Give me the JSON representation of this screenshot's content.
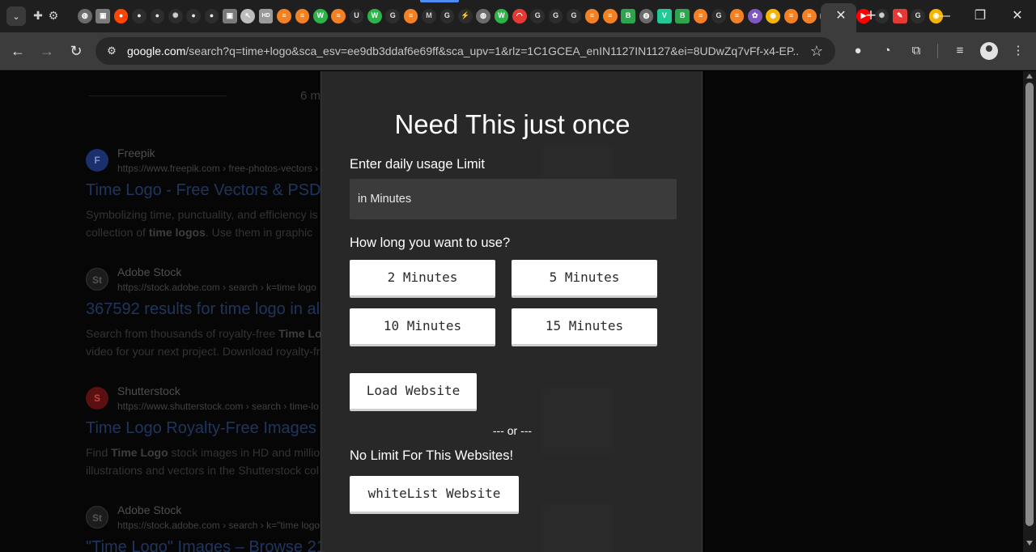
{
  "browser": {
    "address_bar": {
      "host": "google.com",
      "path": "/search?q=time+logo&sca_esv=ee9db3ddaf6e69ff&sca_upv=1&rlz=1C1GCEA_enIN1127IN1127&ei=8UDwZq7vFf-x4-EP..."
    },
    "tabs": [
      {
        "icon": "globe-icon",
        "color": "#6b6b6b"
      },
      {
        "icon": "image-icon",
        "color": "#7a7a7a"
      },
      {
        "icon": "reddit-icon",
        "color": "#ff4500"
      },
      {
        "icon": "github-icon",
        "color": "#e6e6e6"
      },
      {
        "icon": "github-icon",
        "color": "#e6e6e6"
      },
      {
        "icon": "openai-icon",
        "color": "#d0d0d0"
      },
      {
        "icon": "github-icon",
        "color": "#e6e6e6"
      },
      {
        "icon": "github-icon",
        "color": "#e6e6e6"
      },
      {
        "icon": "image-icon",
        "color": "#7a7a7a"
      },
      {
        "icon": "cursor-icon",
        "color": "#bdbdbd"
      },
      {
        "icon": "hd-icon",
        "color": "#9a9a9a"
      },
      {
        "icon": "stackoverflow-icon",
        "color": "#f48024"
      },
      {
        "icon": "stackoverflow-icon",
        "color": "#f48024"
      },
      {
        "icon": "w-icon",
        "color": "#2db34a"
      },
      {
        "icon": "stackoverflow-icon",
        "color": "#f48024"
      },
      {
        "icon": "u-icon",
        "color": "#e6e6e6"
      },
      {
        "icon": "w-icon",
        "color": "#2db34a"
      },
      {
        "icon": "google-icon",
        "color": "#e6e6e6"
      },
      {
        "icon": "stackoverflow-icon",
        "color": "#f48024"
      },
      {
        "icon": "m-icon",
        "color": "#d0d0d0"
      },
      {
        "icon": "google-icon",
        "color": "#e6e6e6"
      },
      {
        "icon": "link-icon",
        "color": "#d0d0d0"
      },
      {
        "icon": "globe-icon",
        "color": "#6b6b6b"
      },
      {
        "icon": "w-icon",
        "color": "#2db34a"
      },
      {
        "icon": "wifi-icon",
        "color": "#e53935"
      },
      {
        "icon": "google-icon",
        "color": "#e6e6e6"
      },
      {
        "icon": "google-icon",
        "color": "#e6e6e6"
      },
      {
        "icon": "google-icon",
        "color": "#e6e6e6"
      },
      {
        "icon": "stackoverflow-icon",
        "color": "#f48024"
      },
      {
        "icon": "stackoverflow-icon",
        "color": "#f48024"
      },
      {
        "icon": "b-icon",
        "color": "#2ea44f"
      },
      {
        "icon": "globe-icon",
        "color": "#6b6b6b"
      },
      {
        "icon": "v-icon",
        "color": "#20c997"
      },
      {
        "icon": "b-icon",
        "color": "#2ea44f"
      },
      {
        "icon": "stackoverflow-icon",
        "color": "#f48024"
      },
      {
        "icon": "google-icon",
        "color": "#e6e6e6"
      },
      {
        "icon": "stackoverflow-icon",
        "color": "#f48024"
      },
      {
        "icon": "ext-icon",
        "color": "#7e57c2"
      },
      {
        "icon": "chrome-icon",
        "color": "#f4b400"
      },
      {
        "icon": "stackoverflow-icon",
        "color": "#f48024"
      },
      {
        "icon": "stackoverflow-icon",
        "color": "#f48024"
      },
      {
        "icon": "stackoverflow-icon",
        "color": "#f48024"
      },
      {
        "icon": "google-icon",
        "color": "#e6e6e6"
      },
      {
        "icon": "youtube-icon",
        "color": "#ff0000"
      },
      {
        "icon": "openai-icon",
        "color": "#d0d0d0"
      },
      {
        "icon": "tool-icon",
        "color": "#e53935"
      },
      {
        "icon": "google-icon",
        "color": "#e6e6e6"
      },
      {
        "icon": "chrome-icon",
        "color": "#f4b400"
      }
    ]
  },
  "background_results": {
    "tab_text": "6 m",
    "results": [
      {
        "logo": "F",
        "logo_color": "#1f3a8a",
        "site": "Freepik",
        "url": "https://www.freepik.com › free-photos-vectors ›",
        "title": "Time Logo - Free Vectors & PSD",
        "snippet_parts": [
          "Symbolizing time, punctuality, and efficiency is",
          "collection of ",
          "time logos",
          ". Use them in graphic"
        ]
      },
      {
        "logo": "St",
        "logo_color": "#1e1e1e",
        "site": "Adobe Stock",
        "url": "https://stock.adobe.com › search › k=time logo",
        "title": "367592 results for time logo in al",
        "snippet_parts": [
          "Search from thousands of royalty-free ",
          "Time Lo",
          "video for your next project. Download royalty-fr"
        ]
      },
      {
        "logo": "S",
        "logo_color": "#6b1111",
        "site": "Shutterstock",
        "url": "https://www.shutterstock.com › search › time-lo",
        "title": "Time Logo Royalty-Free Images",
        "snippet_parts": [
          "Find ",
          "Time Logo",
          " stock images in HD and millio",
          "illustrations and vectors in the Shutterstock col"
        ]
      },
      {
        "logo": "St",
        "logo_color": "#1e1e1e",
        "site": "Adobe Stock",
        "url": "https://stock.adobe.com › search › k=\"time logo",
        "title": "\"Time Logo\" Images – Browse 21",
        "snippet_parts": []
      }
    ]
  },
  "overlay": {
    "title": "Need This just once",
    "limit_label": "Enter daily usage Limit",
    "limit_placeholder": "in Minutes",
    "duration_label": "How long you want to use?",
    "options": [
      "2 Minutes",
      "5 Minutes",
      "10 Minutes",
      "15 Minutes"
    ],
    "load_button": "Load Website",
    "divider": "--- or ---",
    "whitelist_label": "No Limit For This Websites!",
    "whitelist_button": "whiteList Website"
  }
}
